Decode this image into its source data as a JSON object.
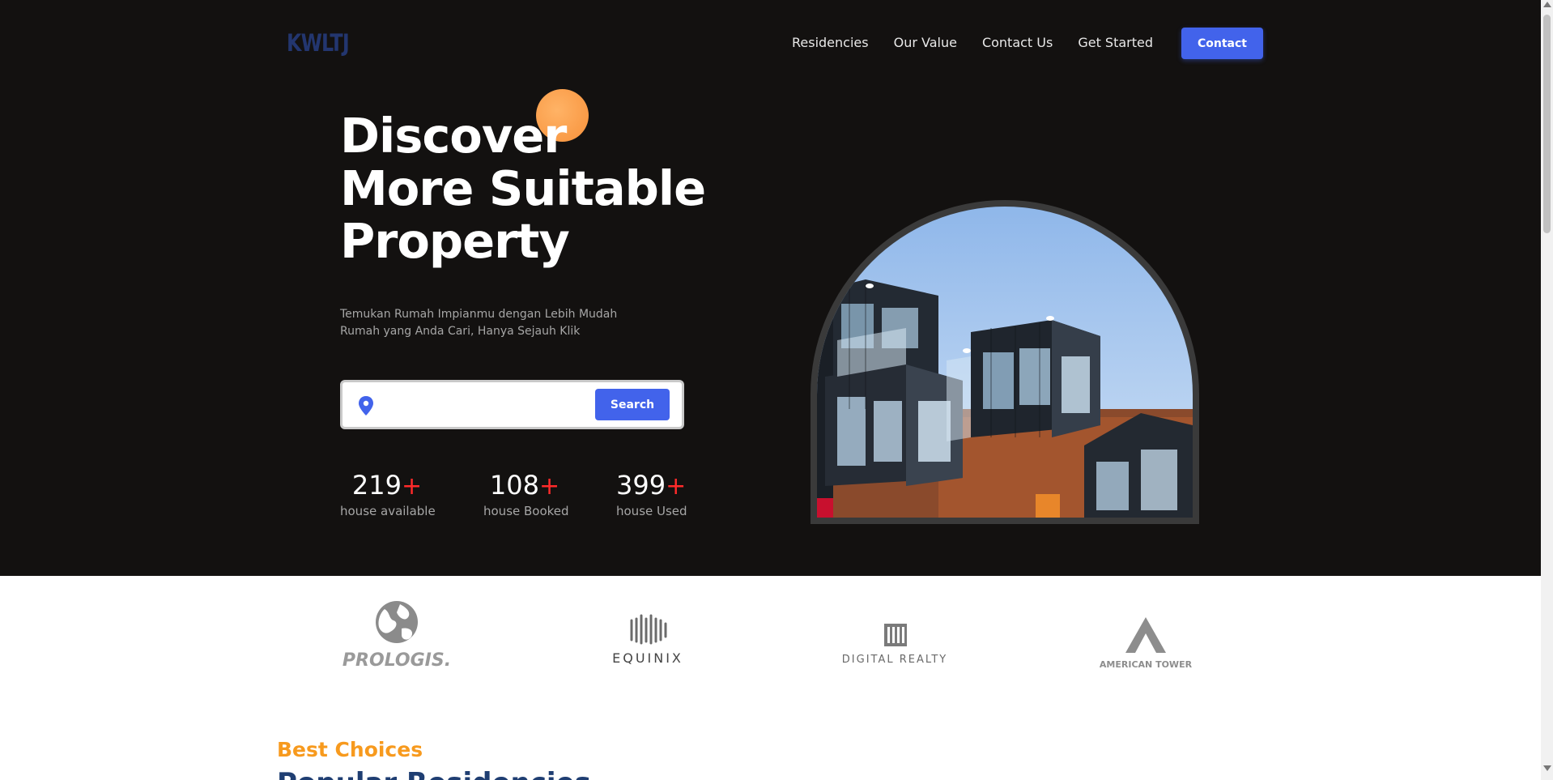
{
  "header": {
    "logo": "KWLTJ",
    "nav": [
      "Residencies",
      "Our Value",
      "Contact Us",
      "Get Started"
    ],
    "contact_button": "Contact"
  },
  "hero": {
    "headline": [
      "Discover",
      "More Suitable",
      "Property"
    ],
    "subtitle": [
      "Temukan Rumah Impianmu dengan Lebih Mudah",
      "Rumah yang Anda Cari, Hanya Sejauh Klik"
    ],
    "search": {
      "placeholder": "",
      "button": "Search"
    },
    "stats": [
      {
        "value": "219",
        "plus": "+",
        "label": "house available"
      },
      {
        "value": "108",
        "plus": "+",
        "label": "house Booked"
      },
      {
        "value": "399",
        "plus": "+",
        "label": "house Used"
      }
    ]
  },
  "partners": [
    "PROLOGIS.",
    "EQUINIX",
    "DIGITAL REALTY",
    "AMERICAN TOWER"
  ],
  "section": {
    "kicker": "Best Choices",
    "title": "Popular Residencies"
  },
  "colors": {
    "accent": "#4263eb",
    "orange": "#f79a1e",
    "hero_bg": "#131110",
    "plus_red": "#ff2a2a",
    "navy": "#1f3e72"
  }
}
